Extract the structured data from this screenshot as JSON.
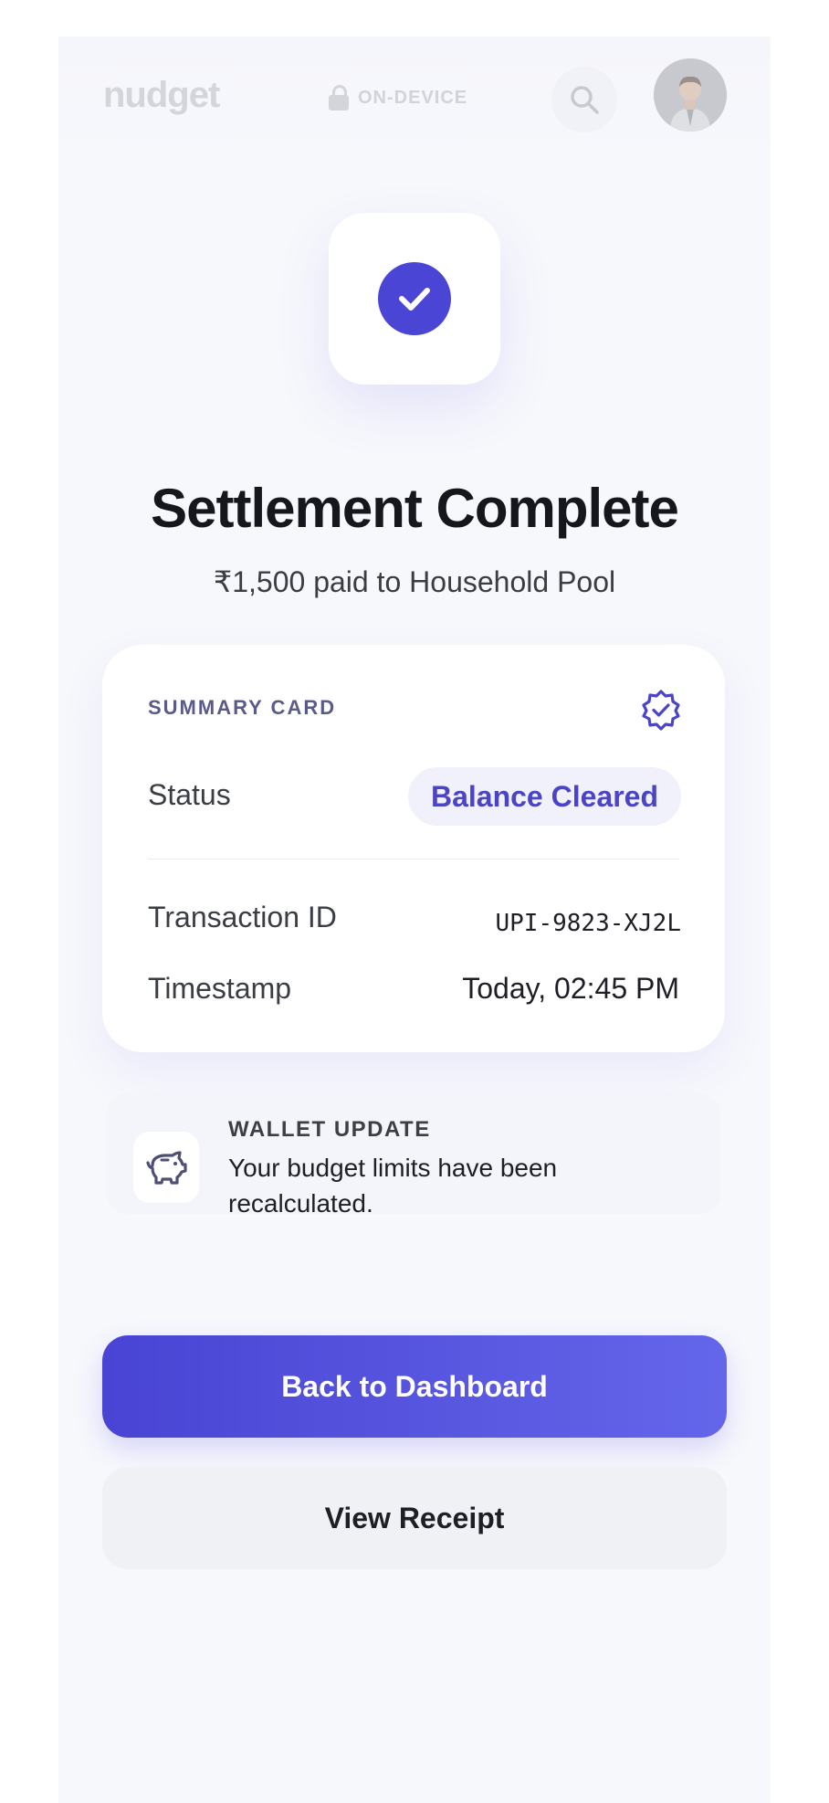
{
  "header": {
    "logo": "nudget",
    "ondevice_label": "ON-DEVICE",
    "search_icon": "search-icon",
    "avatar": "avatar"
  },
  "hero": {
    "icon": "check-circle-icon",
    "title": "Settlement Complete",
    "subtitle": "₹1,500 paid to Household Pool",
    "accent_color": "#4b45d6"
  },
  "summary": {
    "label": "SUMMARY CARD",
    "badge_icon": "verified-badge-icon",
    "status_label": "Status",
    "status_value": "Balance Cleared",
    "transaction_label": "Transaction ID",
    "transaction_value": "UPI-9823-XJ2L",
    "timestamp_label": "Timestamp",
    "timestamp_value": "Today, 02:45 PM"
  },
  "wallet": {
    "icon": "piggy-bank-icon",
    "title": "WALLET UPDATE",
    "text": "Your budget limits have been recalculated."
  },
  "actions": {
    "primary": "Back to Dashboard",
    "secondary": "View Receipt"
  }
}
